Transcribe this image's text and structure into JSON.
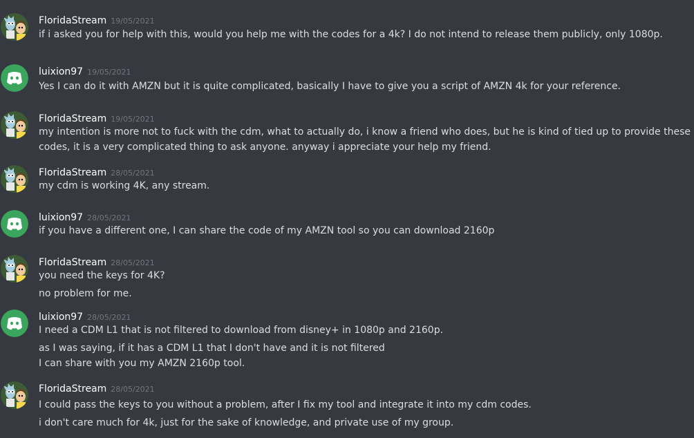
{
  "messages": [
    {
      "author": "FloridaStream",
      "timestamp": "19/05/2021",
      "avatar": "rick-morty-avatar",
      "lines": [
        "if i asked you for help with this, would you help me with the codes for a 4k? I do not intend to release them publicly, only 1080p."
      ]
    },
    {
      "author": "luixion97",
      "timestamp": "19/05/2021",
      "avatar": "discord-default-avatar",
      "lines": [
        "Yes I can do it with AMZN but it is quite complicated, basically I have to give you a script of AMZN 4k for your reference."
      ]
    },
    {
      "author": "FloridaStream",
      "timestamp": "19/05/2021",
      "avatar": "rick-morty-avatar",
      "lines": [
        "my intention is more not to fuck with the cdm, what to actually do, i know a friend who does, but he is kind of tied up to provide these",
        "codes, it is a very complicated thing to ask anyone. anyway i appreciate your help my friend."
      ]
    },
    {
      "author": "FloridaStream",
      "timestamp": "28/05/2021",
      "avatar": "rick-morty-avatar",
      "lines": [
        "my cdm is working 4K, any stream."
      ]
    },
    {
      "author": "luixion97",
      "timestamp": "28/05/2021",
      "avatar": "discord-default-avatar",
      "lines": [
        "if you have a different one, I can share the code of my AMZN tool so you can download 2160p"
      ]
    },
    {
      "author": "FloridaStream",
      "timestamp": "28/05/2021",
      "avatar": "rick-morty-avatar",
      "lines": [
        "you need the keys for 4K?",
        "no problem for me."
      ]
    },
    {
      "author": "luixion97",
      "timestamp": "28/05/2021",
      "avatar": "discord-default-avatar",
      "lines": [
        "I need a CDM L1 that is not filtered to download from disney+ in 1080p and 2160p.",
        "as I was saying, if it has a CDM L1 that I don't have and it is not filtered",
        "I can share with you my AMZN 2160p tool."
      ]
    },
    {
      "author": "FloridaStream",
      "timestamp": "28/05/2021",
      "avatar": "rick-morty-avatar",
      "lines": [
        "I could pass the keys to you without a problem, after I fix my tool and integrate it into my cdm codes.",
        "i don't care much for 4k, just for the sake of knowledge, and private use of my group."
      ]
    }
  ],
  "colors": {
    "background": "#36393f",
    "author": "#ffffff",
    "timestamp": "#72767d",
    "text": "#dcddde",
    "discord_avatar_bg": "#3ba55d",
    "rick_avatar_bg": "#2f4a2a"
  }
}
